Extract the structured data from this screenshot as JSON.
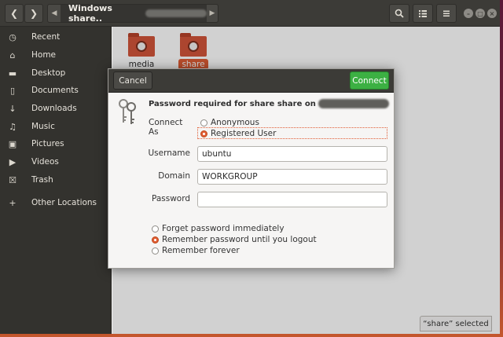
{
  "window": {
    "path_current": "Windows share.."
  },
  "sidebar": {
    "items": [
      {
        "label": "Recent",
        "icon": "clock-icon"
      },
      {
        "label": "Home",
        "icon": "home-icon"
      },
      {
        "label": "Desktop",
        "icon": "folder-icon"
      },
      {
        "label": "Documents",
        "icon": "document-icon"
      },
      {
        "label": "Downloads",
        "icon": "download-icon"
      },
      {
        "label": "Music",
        "icon": "music-icon"
      },
      {
        "label": "Pictures",
        "icon": "camera-icon"
      },
      {
        "label": "Videos",
        "icon": "video-icon"
      },
      {
        "label": "Trash",
        "icon": "trash-icon"
      },
      {
        "label": "Other Locations",
        "icon": "plus-icon"
      }
    ]
  },
  "content": {
    "folders": [
      {
        "name": "media",
        "selected": false
      },
      {
        "name": "share",
        "selected": true
      }
    ],
    "status": "“share” selected"
  },
  "dialog": {
    "cancel_label": "Cancel",
    "connect_label": "Connect",
    "title": "Password required for share share on",
    "connect_as_label": "Connect As",
    "anonymous_label": "Anonymous",
    "registered_label": "Registered User",
    "username_label": "Username",
    "username_value": "ubuntu",
    "domain_label": "Domain",
    "domain_value": "WORKGROUP",
    "password_label": "Password",
    "password_value": "",
    "remember_options": [
      {
        "label": "Forget password immediately",
        "selected": false
      },
      {
        "label": "Remember password until you logout",
        "selected": true
      },
      {
        "label": "Remember forever",
        "selected": false
      }
    ]
  },
  "colors": {
    "accent": "#e05d35",
    "connect_green": "#3cb043",
    "headerbar": "#3c3b37"
  }
}
